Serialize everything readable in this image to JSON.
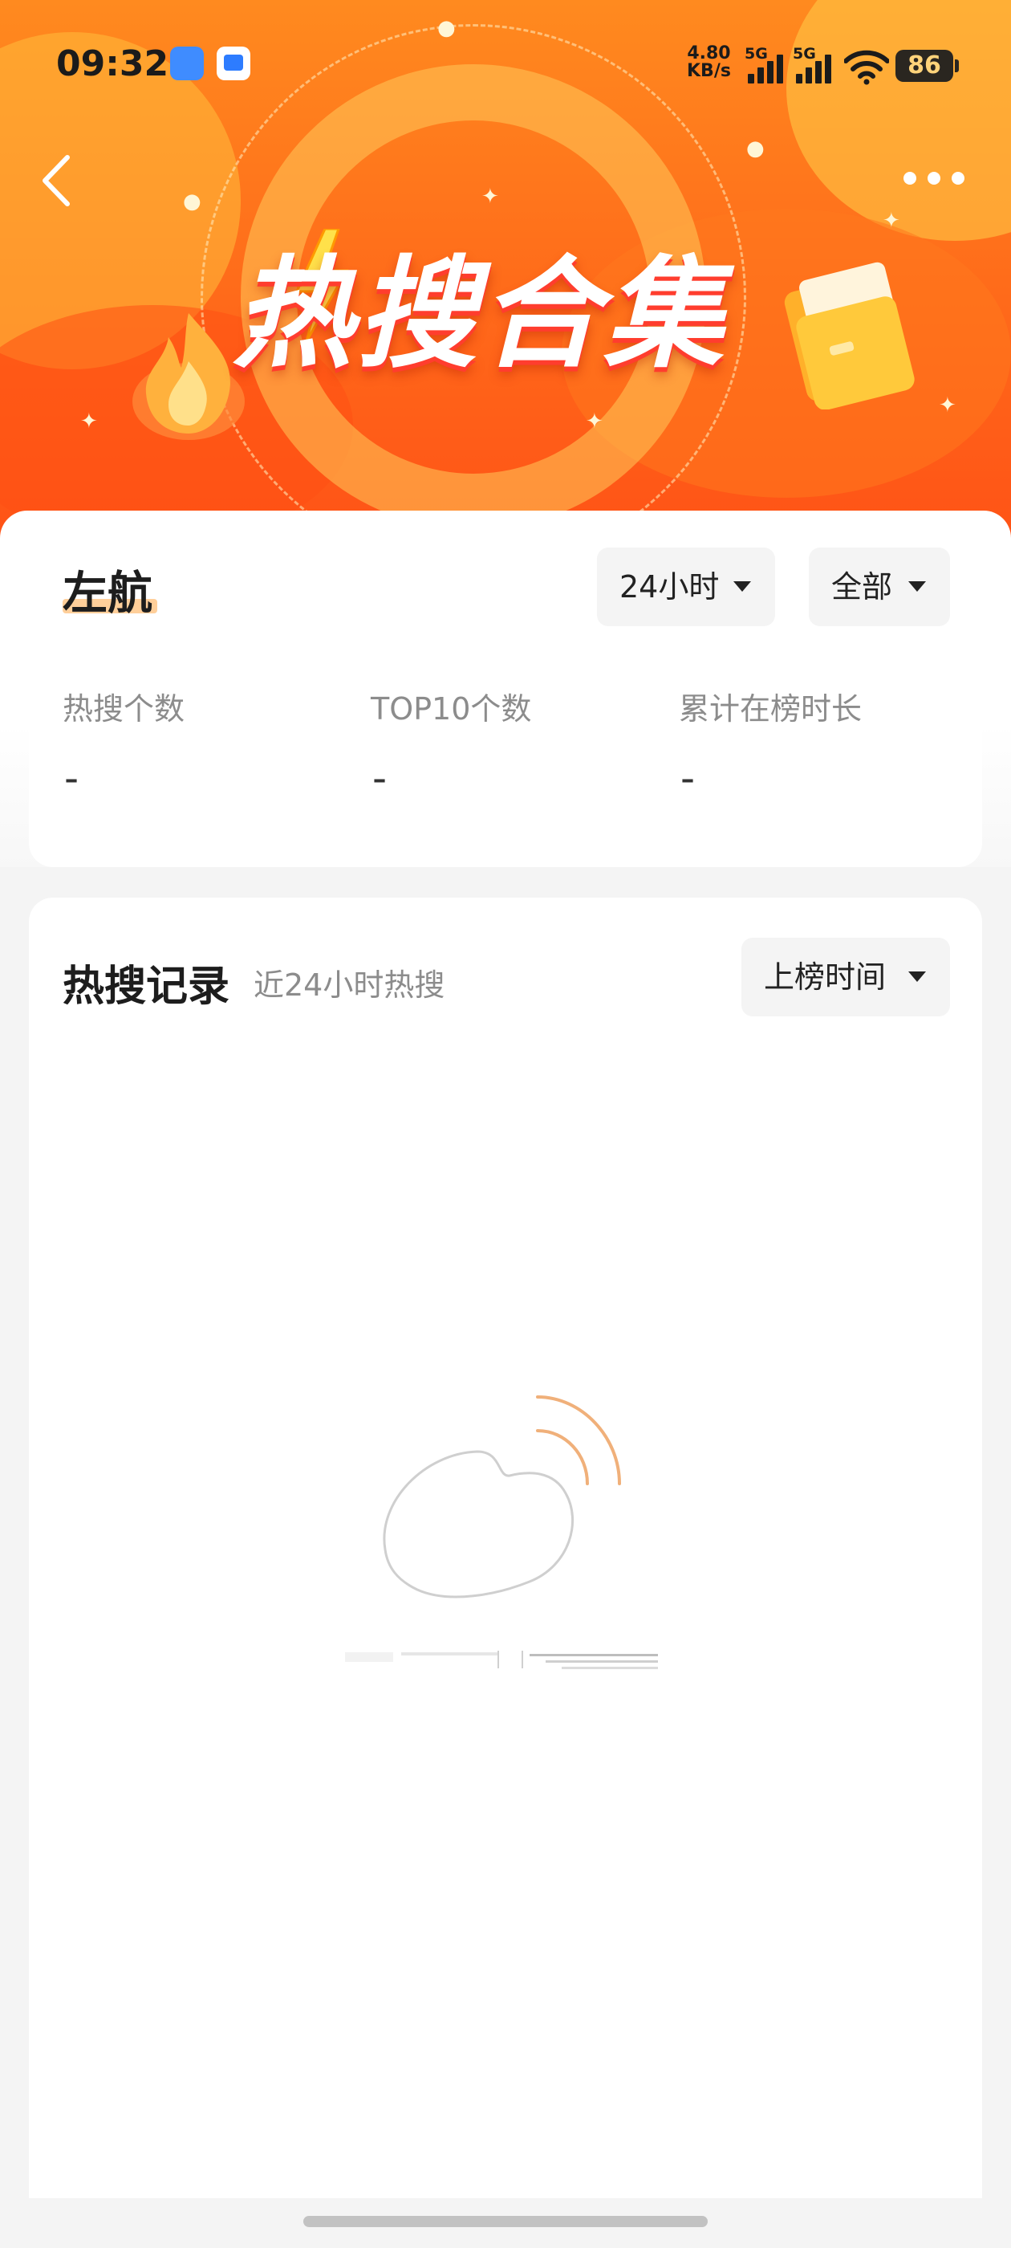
{
  "status_bar": {
    "time": "09:32",
    "net_speed_value": "4.80",
    "net_speed_unit": "KB/s",
    "signal_1": "5G",
    "signal_2": "5G",
    "battery": "86"
  },
  "header": {
    "banner_title": "热搜合集",
    "back_icon": "chevron-left-icon",
    "more_icon": "more-dots-icon"
  },
  "summary": {
    "name": "左航",
    "time_filter": "24小时",
    "scope_filter": "全部",
    "stats": [
      {
        "label": "热搜个数",
        "value": "-"
      },
      {
        "label": "TOP10个数",
        "value": "-"
      },
      {
        "label": "累计在榜时长",
        "value": "-"
      }
    ]
  },
  "records": {
    "title": "热搜记录",
    "subtitle": "近24小时热搜",
    "sort_label": "上榜时间"
  },
  "colors": {
    "banner_orange": "#ff6a1a",
    "accent_underline": "#ffcf9a"
  }
}
